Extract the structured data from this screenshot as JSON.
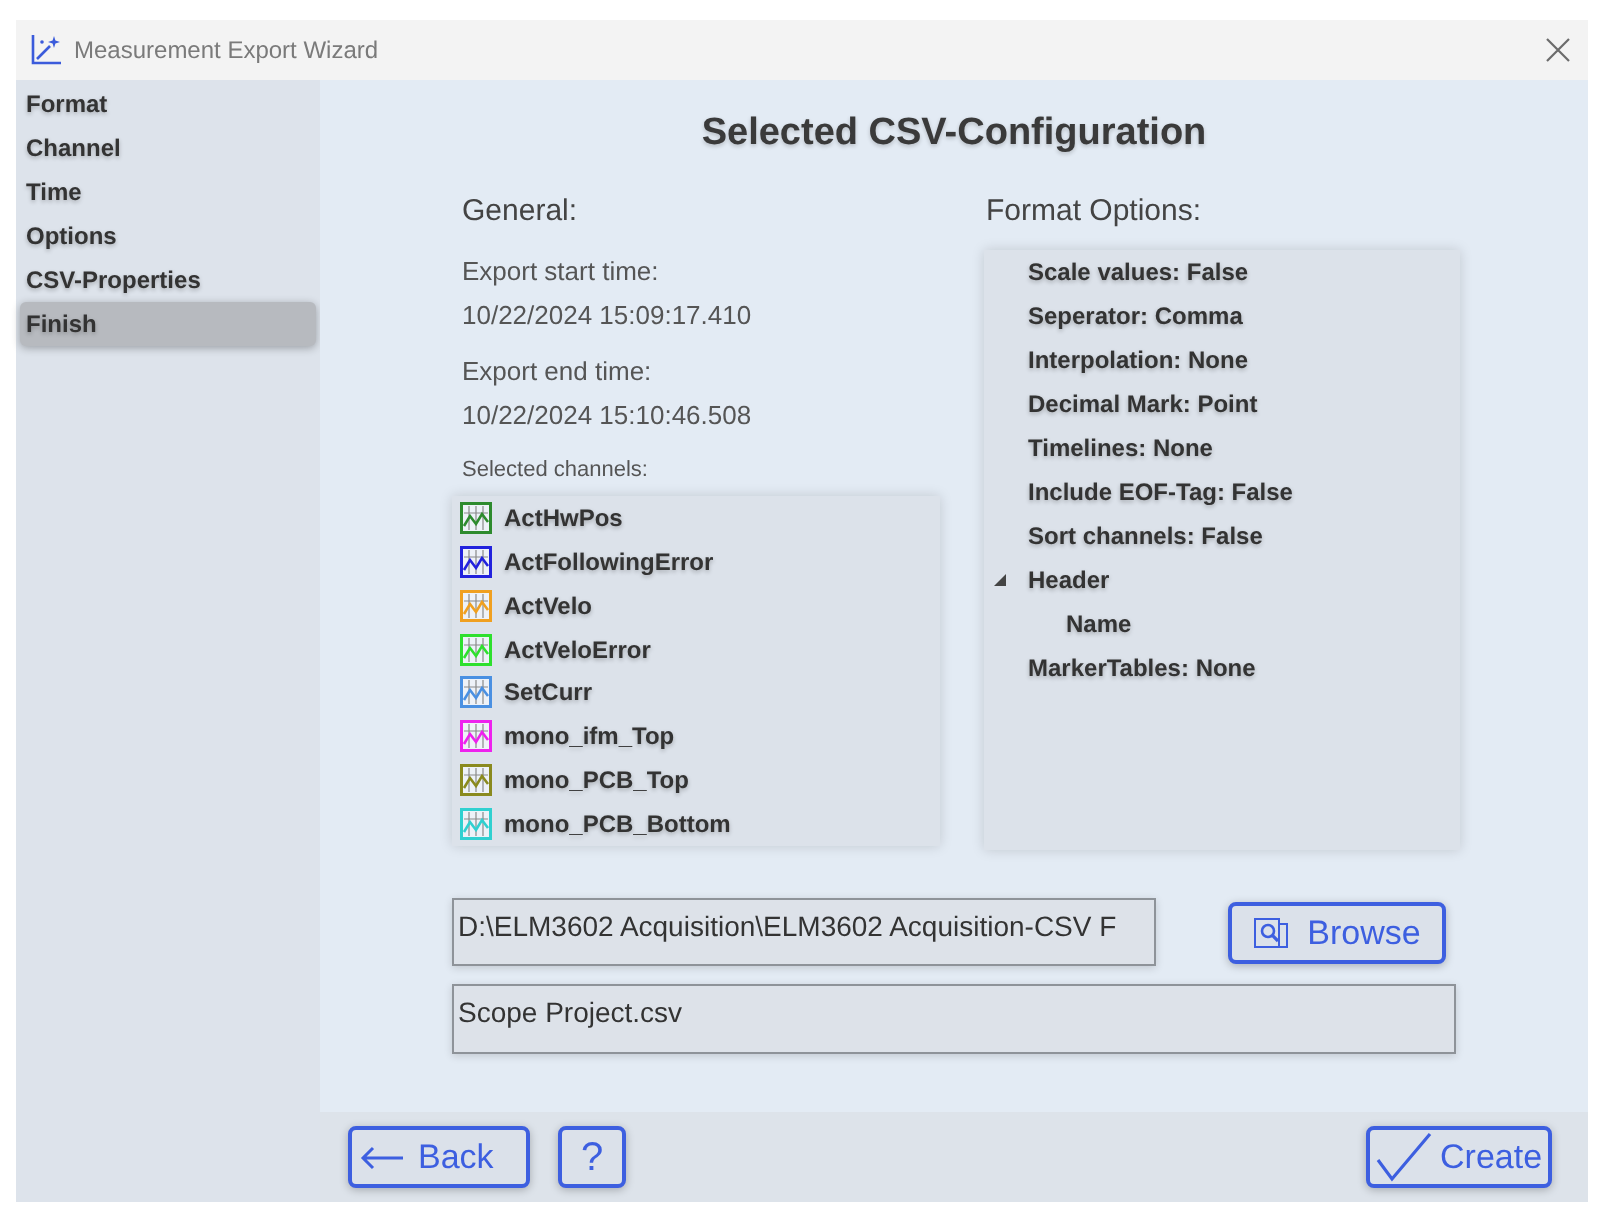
{
  "window": {
    "title": "Measurement Export Wizard"
  },
  "steps": [
    {
      "label": "Format",
      "selected": false
    },
    {
      "label": "Channel",
      "selected": false
    },
    {
      "label": "Time",
      "selected": false
    },
    {
      "label": "Options",
      "selected": false
    },
    {
      "label": "CSV-Properties",
      "selected": false
    },
    {
      "label": "Finish",
      "selected": true
    }
  ],
  "heading": "Selected CSV-Configuration",
  "general": {
    "heading": "General:",
    "fields": [
      {
        "label": "Export start time:",
        "value": "10/22/2024 15:09:17.410"
      },
      {
        "label": "Export end time:",
        "value": "10/22/2024 15:10:46.508"
      }
    ],
    "channels_label": "Selected channels:",
    "channels": [
      {
        "name": "ActHwPos",
        "color": "#2e8b2e"
      },
      {
        "name": "ActFollowingError",
        "color": "#2222dd"
      },
      {
        "name": "ActVelo",
        "color": "#f0a020"
      },
      {
        "name": "ActVeloError",
        "color": "#2ee02e"
      },
      {
        "name": "SetCurr",
        "color": "#4a90e2"
      },
      {
        "name": "mono_ifm_Top",
        "color": "#ee22ee"
      },
      {
        "name": "mono_PCB_Top",
        "color": "#8a8a1e"
      },
      {
        "name": "mono_PCB_Bottom",
        "color": "#30d0d0"
      }
    ]
  },
  "format_options": {
    "heading": "Format Options:",
    "items": [
      {
        "label": "Scale values: False"
      },
      {
        "label": "Seperator: Comma"
      },
      {
        "label": "Interpolation: None"
      },
      {
        "label": "Decimal Mark: Point"
      },
      {
        "label": "Timelines: None"
      },
      {
        "label": "Include EOF-Tag: False"
      },
      {
        "label": "Sort channels: False"
      },
      {
        "label": "Header",
        "expanded": true,
        "children": [
          {
            "label": "Name"
          }
        ]
      },
      {
        "label": "MarkerTables: None"
      }
    ]
  },
  "output": {
    "path": "D:\\ELM3602 Acquisition\\ELM3602 Acquisition-CSV F",
    "file_name": "Scope Project.csv"
  },
  "buttons": {
    "browse": "Browse",
    "back": "Back",
    "help": "?",
    "create": "Create"
  }
}
